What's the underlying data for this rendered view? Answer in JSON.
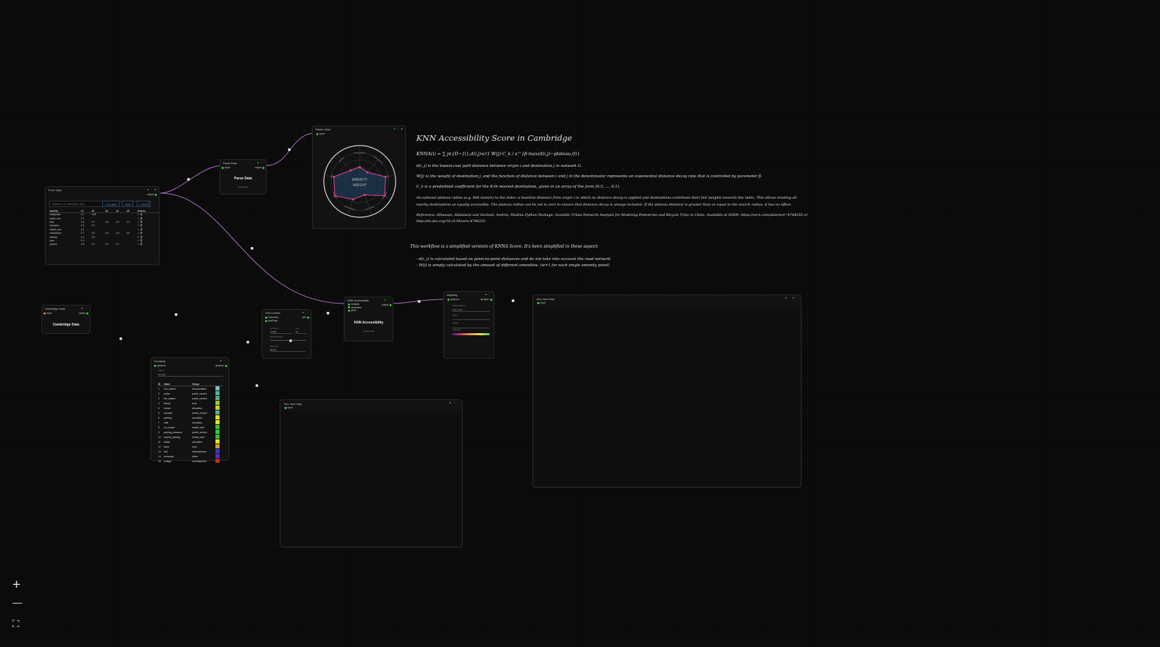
{
  "nodes": {
    "form_input": {
      "title": "Form Input",
      "port_out": "output",
      "search_placeholder": "columns, e.g. name,type,value",
      "btn_columns": "+ COLUMNS",
      "btn_rows": "+ ROW",
      "btn_reset": "⟲ RESET",
      "columns": [
        "amenity",
        "d1",
        "d2",
        "d3",
        "d4",
        "d5",
        "Actions"
      ],
      "rows": [
        [
          "transportat",
          "0.1",
          "0.05",
          "",
          "",
          "",
          ""
        ],
        [
          "public_serv",
          "0.1",
          "",
          "",
          "",
          "",
          ""
        ],
        [
          "food",
          "0.5",
          "0.7",
          "0.6",
          "0.5",
          "0.2",
          ""
        ],
        [
          "education",
          "0.5",
          "0.3",
          "",
          "",
          "",
          ""
        ],
        [
          "health_care",
          "0.2",
          "",
          "",
          "",
          "",
          ""
        ],
        [
          "entertainme",
          "0.7",
          "0.6",
          "0.5",
          "0.5",
          "0.6",
          ""
        ],
        [
          "parking",
          "0.4",
          "0.3",
          "",
          "",
          "",
          ""
        ],
        [
          "bank",
          "0.3",
          "",
          "",
          "",
          "",
          ""
        ],
        [
          "grocery",
          "0.6",
          "0.4",
          "0.2",
          "0.1",
          "",
          ""
        ]
      ]
    },
    "parse_data": {
      "title": "Parse Data",
      "port_in": "input",
      "port_out": "output",
      "label": "Parse Data",
      "sub": "Anonymous"
    },
    "radar_chart": {
      "title": "Radar Chart",
      "port_in": "input",
      "center_line1": "AMENITY",
      "center_line2": "WEIGHT"
    },
    "cambridge_data": {
      "title": "Cambridge Data",
      "port_in": "input",
      "port_out": "output",
      "label": "Cambridge Data"
    },
    "grid_creator": {
      "title": "Grid Creator",
      "port_in1": "boundary",
      "port_in2": "gridData",
      "port_out": "grid",
      "field1": "Grid size",
      "field1_val": "0.0200",
      "field2": "Unit",
      "field2_val": "km",
      "field3": "Grid resolution",
      "field4": "Grid type",
      "field4_val": "square"
    },
    "knn_accessibility": {
      "title": "KNN Accessibility",
      "port_in1": "weights",
      "port_in2": "amenities",
      "port_in3": "grids",
      "port_out": "output",
      "label": "KNN Accessibility",
      "sub": "Anonymous"
    },
    "mapping": {
      "title": "Mapping",
      "port_in": "geojson",
      "port_out": "geojson",
      "field1": "Choose Attribute",
      "field1_val": "knna_score",
      "field2": "Colors",
      "field3": "Classes",
      "field4": "Color ramp"
    },
    "geojson_map": {
      "title": "Geo Json Map",
      "port_in": "input"
    },
    "grouping": {
      "title": "Grouping",
      "port_in": "geojson",
      "port_out": "geojson",
      "field_label": "Column",
      "field_val": "amenity",
      "columns": [
        "ID",
        "Value",
        "Group",
        ""
      ],
      "rows": [
        [
          "1",
          "bus_station",
          "transportation",
          "#6fc0c8"
        ],
        [
          "2",
          "police",
          "public_service",
          "#55b28a"
        ],
        [
          "3",
          "fire_station",
          "public_service",
          "#55b28a"
        ],
        [
          "4",
          "library",
          "food",
          "#9acd32"
        ],
        [
          "5",
          "school",
          "education",
          "#c8d82a"
        ],
        [
          "6",
          "fountain",
          "public_service",
          "#55b28a"
        ],
        [
          "6",
          "parking",
          "education",
          "#d8e020"
        ],
        [
          "7",
          "cafe",
          "education",
          "#e0e818"
        ],
        [
          "8",
          "ice_cream",
          "health_care",
          "#38c038"
        ],
        [
          "9",
          "parking_entrance",
          "public_service",
          "#2ed02e"
        ],
        [
          "10",
          "bicycle_parking",
          "health_care",
          "#30c040"
        ],
        [
          "11",
          "toilets",
          "education",
          "#e8e020"
        ],
        [
          "12",
          "bank",
          "food",
          "#d0a030"
        ],
        [
          "13",
          "fuel",
          "entertainment",
          "#3838c8"
        ],
        [
          "14",
          "university",
          "office",
          "#5a2cc0"
        ],
        [
          "15",
          "college",
          "entertainment",
          "#c02828"
        ]
      ]
    },
    "geojson_map_2": {
      "title": "Geo Json Map",
      "port_in": "input"
    }
  },
  "doc": {
    "title": "KNN Accessibility Score in Cambridge",
    "formula": "KNNA(i) = ∑ j∈{D−{i},d(i,j)≤r}  W(j)·C_k / e^{β·max(d(i,j)−plateau,0)}",
    "line_d": "d(i, j) is the lowest-cost path distance between origin i and destination j in network G.",
    "line_w": "W(j) is the weight of destination j, and the function of distance between i and j in the denominator represents an exponential distance decay rate that is controlled by parameter β.",
    "line_c": "C_k is a predefined coefficient for the K-th nearest destination, given in an array of the form (0.5, ..., 0.1).",
    "line_plateau1": "An optional plateau radius (e.g. 400 meters) to the index: a baseline distance from origin i in which no distance decay is applied and destinations contribute their full weights towards the index. This allows treating all",
    "line_plateau2": "nearby destinations as equally accessible. The plateau radius can be set to zero to ensure that distance decay is always included. If the plateau distance is greater than or equal to the search radius, it has no effect.",
    "line_ref1": "Reference: Alhassan, Abdulaziz and Sevtsuk, Andres, Madina Python Package: Scalable Urban Network Analysis for Modeling Pedestrian and Bicycle Trips in Cities. Available at SSRN: https://ssrn.com/abstract=4748255 or",
    "line_ref2": "http://dx.doi.org/10.2139/ssrn.4748255",
    "simplified": "This workflow is a simplified versioin of KNNA Score. It's been simplified in these aspect:",
    "bullet1": "- d(i, j) is calculated based on point-to-point distances and do not take into account the road network",
    "bullet2": "- W(j) is simply calculated by the amount of different amenities. (w=1 for each single amenity point)"
  },
  "radar": {
    "axes": [
      "transportation",
      "public_service",
      "food",
      "education",
      "health_care",
      "entertainment",
      "parking",
      "bank",
      "grocery"
    ],
    "values": [
      0.3,
      0.25,
      0.55,
      0.6,
      0.3,
      0.4,
      0.6,
      0.55,
      0.3
    ],
    "max": 0.6,
    "stroke": "#d04090",
    "fill": "#1e3a55"
  },
  "colors": {
    "wire": "#b070c8",
    "accent_green": "#3ecf4a",
    "accent_orange": "#e8a020",
    "ramp": [
      "#5b1a6e",
      "#d04060",
      "#e8a040",
      "#f0e060",
      "#60c060"
    ]
  },
  "zoom": {
    "plus": "+",
    "minus": "—",
    "fit": "⛶"
  }
}
